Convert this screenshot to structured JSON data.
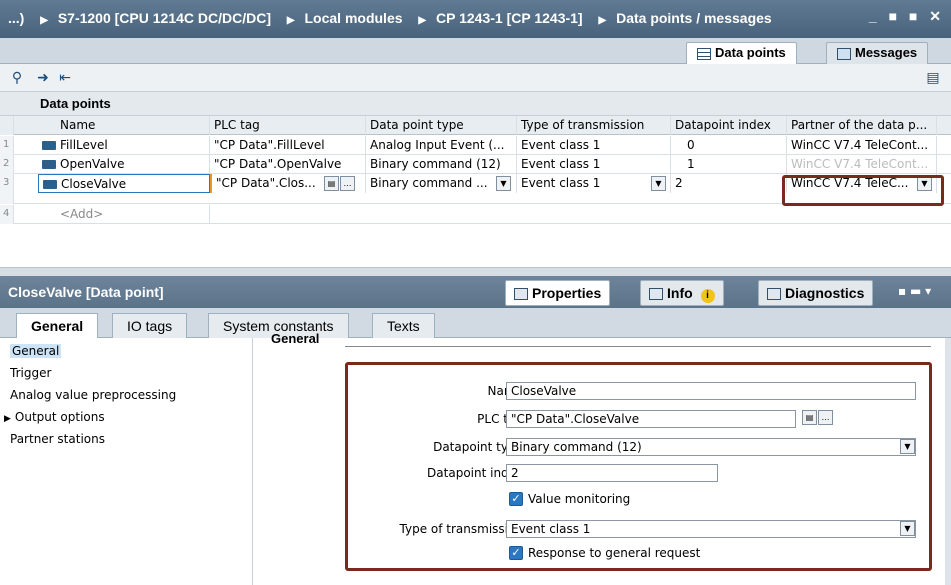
{
  "breadcrumb": {
    "items": [
      "...)",
      "S7-1200 [CPU 1214C DC/DC/DC]",
      "Local modules",
      "CP 1243-1 [CP 1243-1]",
      "Data points / messages"
    ],
    "separator": "▶"
  },
  "window_controls": "_ ■ ■ ✕",
  "view_tabs": {
    "data_points": "Data points",
    "messages": "Messages"
  },
  "table": {
    "title": "Data points",
    "columns": [
      "Name",
      "PLC tag",
      "Data point type",
      "Type of transmission",
      "Datapoint index",
      "Partner of the data p..."
    ],
    "rows": [
      {
        "num": "1",
        "name": "FillLevel",
        "plc_tag": "\"CP Data\".FillLevel",
        "type": "Analog Input Event (...",
        "transmission": "Event class 1",
        "index": "0",
        "partner": "WinCC V7.4 TeleCont..."
      },
      {
        "num": "2",
        "name": "OpenValve",
        "plc_tag": "\"CP Data\".OpenValve",
        "type": "Binary command (12)",
        "transmission": "Event class 1",
        "index": "1",
        "partner": "WinCC V7.4 TeleCont..."
      },
      {
        "num": "3",
        "name": "CloseValve",
        "plc_tag": "\"CP Data\".Clos...",
        "type": "Binary command ...",
        "transmission": "Event class 1",
        "index": "2",
        "partner": "WinCC V7.4 TeleC..."
      }
    ],
    "add_row": {
      "num": "4",
      "label": "<Add>"
    }
  },
  "inspector": {
    "title": "CloseValve [Data point]",
    "tabs": {
      "properties": "Properties",
      "info": "Info",
      "diagnostics": "Diagnostics"
    }
  },
  "subtabs": [
    "General",
    "IO tags",
    "System constants",
    "Texts"
  ],
  "nav": {
    "items": [
      "General",
      "Trigger",
      "Analog value preprocessing",
      "Output options",
      "Partner stations"
    ]
  },
  "form": {
    "section": "General",
    "name_label": "Name:",
    "name_value": "CloseValve",
    "plctag_label": "PLC tag:",
    "plctag_value": "\"CP Data\".CloseValve",
    "dptype_label": "Datapoint type:",
    "dptype_value": "Binary command (12)",
    "dpindex_label": "Datapoint index:",
    "dpindex_value": "2",
    "value_monitoring": "Value monitoring",
    "transmission_label": "Type of transmission:",
    "transmission_value": "Event class 1",
    "response": "Response to general request"
  }
}
